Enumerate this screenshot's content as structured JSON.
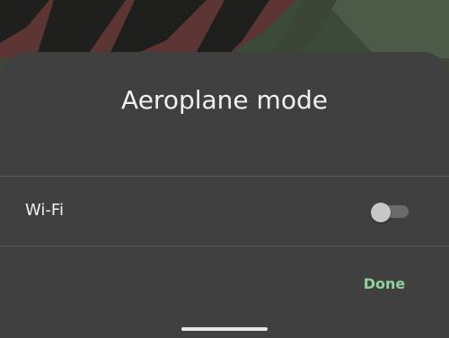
{
  "dialog": {
    "title": "Aeroplane mode",
    "toggle": {
      "label": "Wi-Fi",
      "state": "off"
    },
    "done_label": "Done"
  },
  "colors": {
    "sheet_background": "#404040",
    "accent": "#8fd39a",
    "wallpaper_green": "#3f463c",
    "wallpaper_red": "#5d3633",
    "wallpaper_dark": "#1d1e1b"
  },
  "icons": {
    "nav_handle": "gesture-nav-handle"
  }
}
